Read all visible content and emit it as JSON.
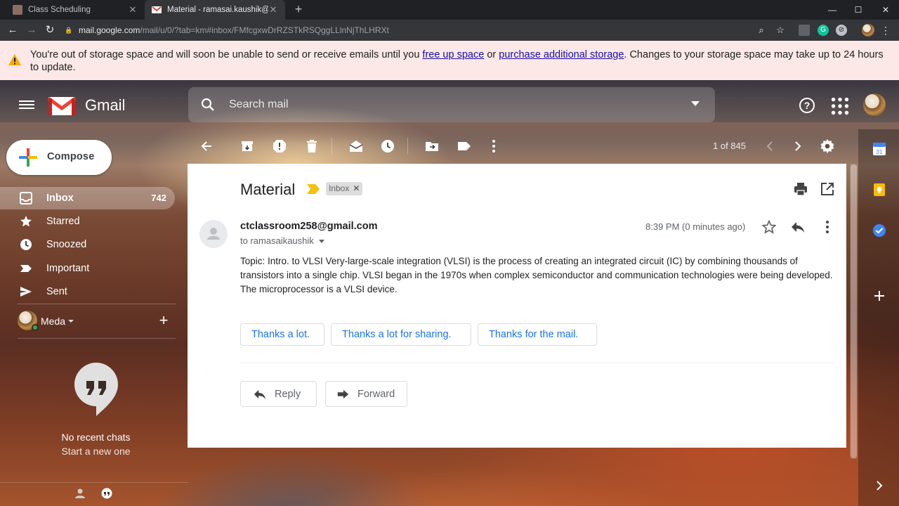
{
  "browser": {
    "tabs": [
      {
        "title": "Class Scheduling",
        "active": false
      },
      {
        "title": "Material - ramasai.kaushik@gmai",
        "active": true
      }
    ],
    "url_host": "mail.google.com",
    "url_path": "/mail/u/0/?tab=km#inbox/FMfcgxwDrRZSTkRSQggLLlnNjThLHRXt"
  },
  "banner": {
    "text_before": "You're out of storage space and will soon be unable to send or receive emails until you ",
    "link1": "free up space",
    "text_middle": " or ",
    "link2": "purchase additional storage",
    "text_after": ". Changes to your storage space may take up to 24 hours to update."
  },
  "header": {
    "app_name": "Gmail",
    "search_placeholder": "Search mail"
  },
  "compose": {
    "label": "Compose"
  },
  "nav": [
    {
      "label": "Inbox",
      "count": "742",
      "icon": "inbox-icon",
      "active": true
    },
    {
      "label": "Starred",
      "count": "",
      "icon": "star-icon",
      "active": false
    },
    {
      "label": "Snoozed",
      "count": "",
      "icon": "clock-icon",
      "active": false
    },
    {
      "label": "Important",
      "count": "",
      "icon": "important-icon",
      "active": false
    },
    {
      "label": "Sent",
      "count": "",
      "icon": "send-icon",
      "active": false
    }
  ],
  "hangouts": {
    "user": "Meda",
    "no_chats": "No recent chats",
    "start_new": "Start a new one"
  },
  "toolbar": {
    "page_count": "1 of 845"
  },
  "message": {
    "subject": "Material",
    "label_chip": "Inbox",
    "sender": "ctclassroom258@gmail.com",
    "to": "to ramasaikaushik",
    "time": "8:39 PM (0 minutes ago)",
    "body": "Topic: Intro. to VLSI Very-large-scale integration (VLSI) is the process of creating an integrated circuit (IC) by combining thousands of transistors into a single chip. VLSI began in the 1970s when complex semiconductor and communication technologies were being developed. The microprocessor is a VLSI device.",
    "smart_replies": [
      "Thanks a lot.",
      "Thanks a lot for sharing.",
      "Thanks for the mail."
    ],
    "reply_label": "Reply",
    "forward_label": "Forward"
  },
  "colors": {
    "accent_blue": "#1a73e8",
    "banner_bg": "#fce8e6",
    "chip_bg": "#dddddd"
  }
}
